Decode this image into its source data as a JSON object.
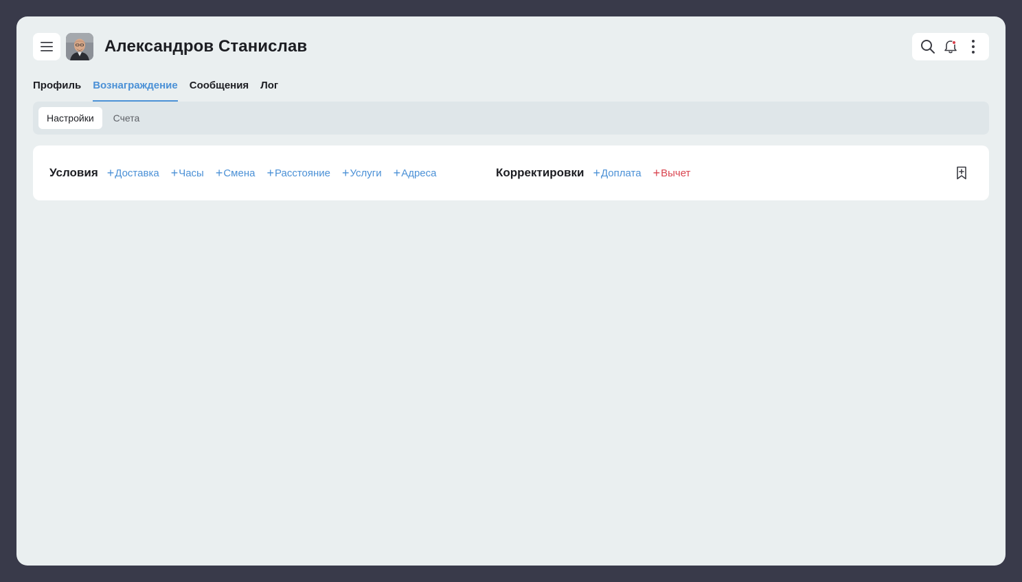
{
  "header": {
    "title": "Александров Станислав",
    "menu_icon": "hamburger-icon",
    "avatar_icon": "user-photo"
  },
  "tabs": [
    {
      "label": "Профиль",
      "active": false
    },
    {
      "label": "Вознаграждение",
      "active": true
    },
    {
      "label": "Сообщения",
      "active": false
    },
    {
      "label": "Лог",
      "active": false
    }
  ],
  "subtabs": [
    {
      "label": "Настройки",
      "active": true
    },
    {
      "label": "Счета",
      "active": false
    }
  ],
  "conditions": {
    "title": "Условия",
    "items": [
      "Доставка",
      "Часы",
      "Смена",
      "Расстояние",
      "Услуги",
      "Адреса"
    ]
  },
  "adjustments": {
    "title": "Корректировки",
    "items": [
      "Доплата",
      "Вычет"
    ]
  },
  "colors": {
    "accent": "#4a90d6",
    "danger": "#d9434e",
    "background": "#393a4a",
    "surface": "#eaeff0"
  }
}
